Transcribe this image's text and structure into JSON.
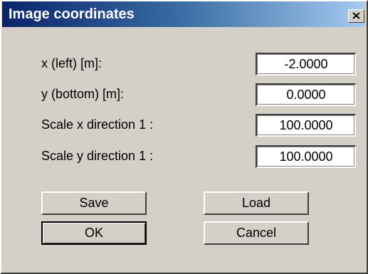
{
  "window": {
    "title": "Image coordinates",
    "close_icon": "close-icon"
  },
  "fields": [
    {
      "label": "x (left) [m]:",
      "value": "-2.0000"
    },
    {
      "label": "y (bottom) [m]:",
      "value": "0.0000"
    },
    {
      "label": "Scale x direction 1 :",
      "value": "100.0000"
    },
    {
      "label": "Scale y direction 1 :",
      "value": "100.0000"
    }
  ],
  "buttons": {
    "save": "Save",
    "load": "Load",
    "ok": "OK",
    "cancel": "Cancel"
  },
  "colors": {
    "titlebar_start": "#0a246a",
    "titlebar_end": "#a6caf0",
    "dialog_face": "#d4d0c8"
  }
}
